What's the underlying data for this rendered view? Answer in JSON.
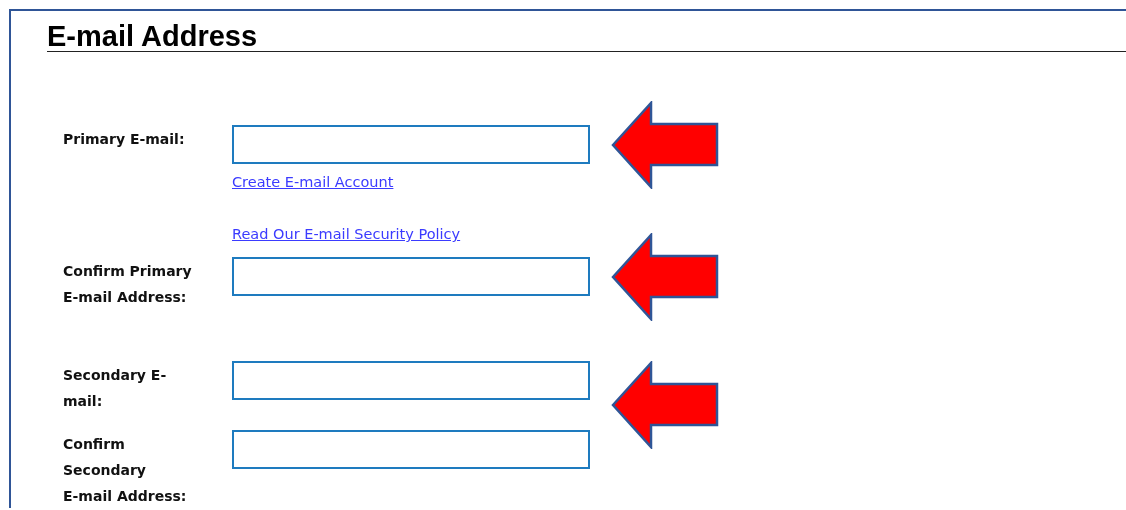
{
  "section": {
    "title": "E-mail Address"
  },
  "groups": [
    {
      "arrow": false,
      "items": [
        {
          "kind": "field",
          "label": "Primary E-mail:",
          "value": "",
          "arrow": true
        },
        {
          "kind": "link",
          "text": "Create E-mail Account"
        },
        {
          "kind": "link",
          "text": "Read Our E-mail Security Policy"
        },
        {
          "kind": "field",
          "label": "Confirm Primary\nE-mail Address:",
          "value": "",
          "arrow": true
        }
      ]
    },
    {
      "arrow": true,
      "items": [
        {
          "kind": "field",
          "label": "Secondary E-\nmail:",
          "value": "",
          "arrow": false
        },
        {
          "kind": "field",
          "label": "Confirm\nSecondary\nE-mail Address:",
          "value": "",
          "arrow": false
        }
      ]
    }
  ]
}
